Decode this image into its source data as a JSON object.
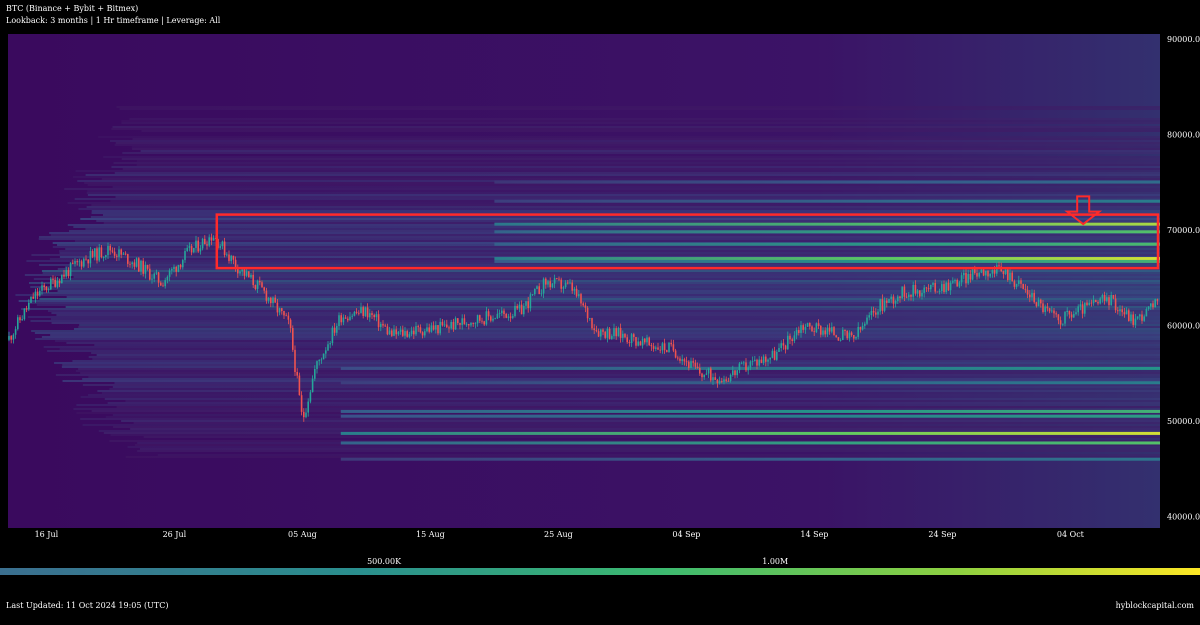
{
  "header": {
    "title": "BTC (Binance + Bybit + Bitmex)",
    "subtitle": "Lookback: 3 months | 1 Hr timeframe | Leverage: All"
  },
  "footer": {
    "updated": "Last Updated: 11 Oct 2024 19:05 (UTC)",
    "brand": "hyblockcapital.com"
  },
  "colors": {
    "background": "#000000",
    "heatmap_low": "#440154",
    "heatmap_mid": "#21918c",
    "heatmap_high": "#fde725",
    "candle_up": "#26a69a",
    "candle_down": "#ef5350",
    "highlight_box": "#ff2a2a",
    "arrow": "#ff2a2a"
  },
  "chart_data": {
    "type": "heatmap",
    "x_tick_labels": [
      "16 Jul",
      "26 Jul",
      "05 Aug",
      "15 Aug",
      "25 Aug",
      "04 Sep",
      "14 Sep",
      "24 Sep",
      "04 Oct"
    ],
    "x_range": [
      "2024-07-13",
      "2024-10-11"
    ],
    "y_tick_labels": [
      "40000.0",
      "50000.0",
      "60000.0",
      "70000.0",
      "80000.0",
      "90000.0"
    ],
    "y_ticks": [
      40000,
      50000,
      60000,
      70000,
      80000,
      90000
    ],
    "ylim": [
      38800,
      90500
    ],
    "colorbar": {
      "tick_labels": [
        "500.00K",
        "1.00M"
      ],
      "ticks": [
        500000,
        1000000
      ],
      "range": [
        0,
        1550000
      ]
    },
    "liquidation_levels": [
      {
        "price": 70600,
        "value": 1350000
      },
      {
        "price": 69800,
        "value": 1100000
      },
      {
        "price": 68500,
        "value": 1050000
      },
      {
        "price": 67000,
        "value": 1450000
      },
      {
        "price": 66700,
        "value": 1000000
      },
      {
        "price": 73000,
        "value": 650000
      },
      {
        "price": 75000,
        "value": 550000
      },
      {
        "price": 55500,
        "value": 800000
      },
      {
        "price": 54000,
        "value": 650000
      },
      {
        "price": 51000,
        "value": 1000000
      },
      {
        "price": 50500,
        "value": 850000
      },
      {
        "price": 48700,
        "value": 1450000
      },
      {
        "price": 47700,
        "value": 1100000
      },
      {
        "price": 46000,
        "value": 600000
      }
    ],
    "price_path": {
      "dates": [
        "2024-07-13",
        "2024-07-15",
        "2024-07-17",
        "2024-07-19",
        "2024-07-21",
        "2024-07-23",
        "2024-07-25",
        "2024-07-27",
        "2024-07-29",
        "2024-07-31",
        "2024-08-02",
        "2024-08-04",
        "2024-08-05",
        "2024-08-06",
        "2024-08-08",
        "2024-08-10",
        "2024-08-12",
        "2024-08-14",
        "2024-08-16",
        "2024-08-18",
        "2024-08-20",
        "2024-08-22",
        "2024-08-24",
        "2024-08-26",
        "2024-08-28",
        "2024-08-30",
        "2024-09-01",
        "2024-09-03",
        "2024-09-05",
        "2024-09-07",
        "2024-09-09",
        "2024-09-11",
        "2024-09-13",
        "2024-09-15",
        "2024-09-17",
        "2024-09-19",
        "2024-09-21",
        "2024-09-23",
        "2024-09-25",
        "2024-09-27",
        "2024-09-29",
        "2024-10-01",
        "2024-10-03",
        "2024-10-05",
        "2024-10-07",
        "2024-10-09",
        "2024-10-11"
      ],
      "prices": [
        58500,
        63000,
        65000,
        67000,
        68000,
        66500,
        64500,
        67500,
        69500,
        66000,
        63500,
        60000,
        50000,
        55500,
        61000,
        61500,
        59000,
        59500,
        59800,
        60500,
        61000,
        61500,
        64500,
        64000,
        59500,
        59000,
        58000,
        57500,
        55000,
        54500,
        56000,
        57000,
        60000,
        59500,
        58500,
        62000,
        63500,
        63800,
        64500,
        65800,
        65500,
        63000,
        60500,
        61800,
        62800,
        60500,
        62500
      ]
    },
    "annotations": [
      {
        "type": "rectangle",
        "price_low": 66000,
        "price_high": 71600,
        "date_start": "2024-07-29",
        "date_end": "2024-10-11"
      },
      {
        "type": "arrow-down",
        "date": "2024-10-05",
        "price_top": 73500,
        "price_tip": 70600
      }
    ],
    "grid": false,
    "legend": "colorbar-bottom"
  }
}
